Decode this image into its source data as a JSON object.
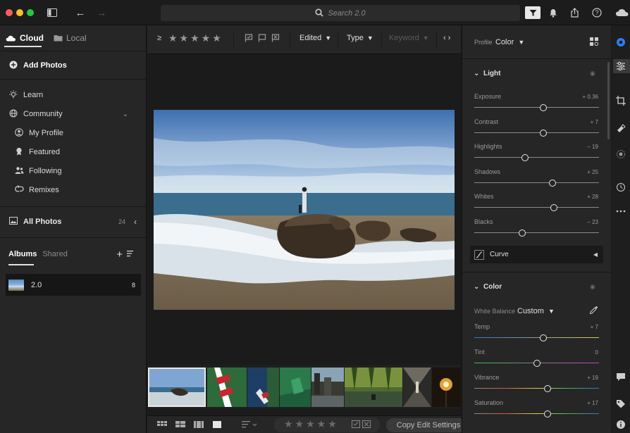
{
  "titlebar": {
    "search_placeholder": "Search 2.0"
  },
  "left": {
    "tabs": [
      {
        "label": "Cloud",
        "active": true
      },
      {
        "label": "Local",
        "active": false
      }
    ],
    "add_photos": "Add Photos",
    "learn": "Learn",
    "community": "Community",
    "community_items": [
      "My Profile",
      "Featured",
      "Following",
      "Remixes"
    ],
    "all_photos": "All Photos",
    "all_photos_count": "24",
    "albums_tab": "Albums",
    "shared_tab": "Shared",
    "album": {
      "name": "2.0",
      "count": "8"
    }
  },
  "filterbar": {
    "rating_op": "≥",
    "rating": 5,
    "edited": "Edited",
    "type": "Type",
    "keyword": "Keyword"
  },
  "bottombar": {
    "copy_edit": "Copy Edit Settings"
  },
  "right": {
    "profile_label": "Profile",
    "profile_value": "Color",
    "light_section": "Light",
    "light_sliders": [
      {
        "name": "Exposure",
        "value": "+ 0.36",
        "pos": 0.555
      },
      {
        "name": "Contrast",
        "value": "+ 7",
        "pos": 0.555
      },
      {
        "name": "Highlights",
        "value": "– 19",
        "pos": 0.405
      },
      {
        "name": "Shadows",
        "value": "+ 25",
        "pos": 0.625
      },
      {
        "name": "Whites",
        "value": "+ 28",
        "pos": 0.64
      },
      {
        "name": "Blacks",
        "value": "– 23",
        "pos": 0.385
      }
    ],
    "curve": "Curve",
    "color_section": "Color",
    "wb_label": "White Balance",
    "wb_value": "Custom",
    "color_sliders": [
      {
        "name": "Temp",
        "value": "+ 7",
        "pos": 0.555
      },
      {
        "name": "Tint",
        "value": "0",
        "pos": 0.5
      },
      {
        "name": "Vibrance",
        "value": "+ 19",
        "pos": 0.59
      },
      {
        "name": "Saturation",
        "value": "+ 17",
        "pos": 0.585
      }
    ]
  },
  "colors": {
    "panel": "#262626",
    "background": "#1b1b1b",
    "accent": "#e8e8e8"
  }
}
